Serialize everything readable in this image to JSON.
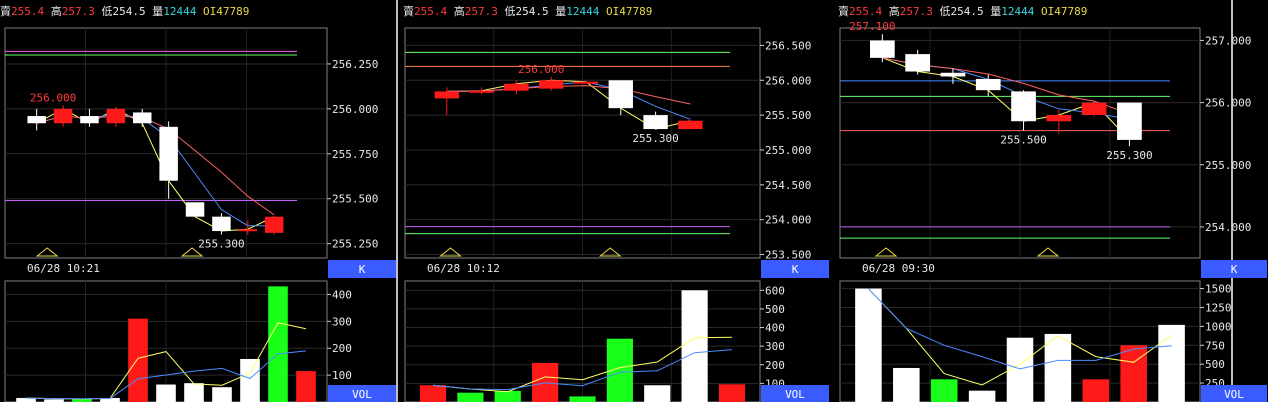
{
  "panels": [
    {
      "stat": {
        "sell_label": "賣",
        "sell": "255.4",
        "high_label": "高",
        "high": "257.3",
        "low_label": "低",
        "low": "254.5",
        "vol_label": "量",
        "vol": "12444",
        "oi_label": "OI",
        "oi": "47789"
      },
      "time_label": "06/28 10:21",
      "k_button": "K",
      "vol_button": "VOL",
      "price_ticks": [
        "256.250",
        "256.000",
        "255.750",
        "255.500",
        "255.250"
      ],
      "vol_ticks": [
        "400",
        "300",
        "200",
        "100"
      ]
    },
    {
      "stat": {
        "sell_label": "賣",
        "sell": "255.4",
        "high_label": "高",
        "high": "257.3",
        "low_label": "低",
        "low": "254.5",
        "vol_label": "量",
        "vol": "12444",
        "oi_label": "OI",
        "oi": "47789"
      },
      "time_label": "06/28 10:12",
      "k_button": "K",
      "vol_button": "VOL",
      "price_ticks": [
        "256.500",
        "256.000",
        "255.500",
        "255.000",
        "254.500",
        "254.000",
        "253.500"
      ],
      "vol_ticks": [
        "600",
        "500",
        "400",
        "300",
        "200",
        "100"
      ]
    },
    {
      "stat": {
        "sell_label": "賣",
        "sell": "255.4",
        "high_label": "高",
        "high": "257.3",
        "low_label": "低",
        "low": "254.5",
        "vol_label": "量",
        "vol": "12444",
        "oi_label": "OI",
        "oi": "47789"
      },
      "time_label": "06/28 09:30",
      "k_button": "K",
      "vol_button": "VOL",
      "price_ticks": [
        "257.000",
        "256.000",
        "255.000",
        "254.000"
      ],
      "vol_ticks": [
        "1500",
        "1250",
        "1000",
        "750",
        "500",
        "250"
      ]
    }
  ],
  "colors": {
    "up": "#ff1a1a",
    "down": "#ffffff",
    "up_vol": "#ff1a1a",
    "down_vol": "#ffffff",
    "green_vol": "#1aff1a",
    "axis_bg": "#3a5bff",
    "label_red": "#ff3b3b"
  },
  "chart_data": [
    {
      "type": "candlestick",
      "price_range": [
        255.17,
        256.45
      ],
      "vol_range": [
        0,
        450
      ],
      "candles": [
        {
          "o": 255.96,
          "c": 255.92,
          "h": 256.0,
          "l": 255.88
        },
        {
          "o": 255.92,
          "c": 256.0,
          "h": 256.02,
          "l": 255.9
        },
        {
          "o": 255.96,
          "c": 255.92,
          "h": 256.0,
          "l": 255.9
        },
        {
          "o": 255.92,
          "c": 256.0,
          "h": 256.01,
          "l": 255.9
        },
        {
          "o": 255.98,
          "c": 255.92,
          "h": 256.0,
          "l": 255.9
        },
        {
          "o": 255.9,
          "c": 255.6,
          "h": 255.93,
          "l": 255.5
        },
        {
          "o": 255.48,
          "c": 255.4,
          "h": 255.48,
          "l": 255.4
        },
        {
          "o": 255.4,
          "c": 255.32,
          "h": 255.42,
          "l": 255.3
        },
        {
          "o": 255.32,
          "c": 255.33,
          "h": 255.38,
          "l": 255.3
        },
        {
          "o": 255.31,
          "c": 255.4,
          "h": 255.4,
          "l": 255.3
        }
      ],
      "hi_label": "256.000",
      "lo_label": "255.300",
      "volumes": [
        15,
        10,
        12,
        15,
        310,
        65,
        70,
        55,
        160,
        430,
        115
      ],
      "vol_colors": [
        "w",
        "w",
        "g",
        "w",
        "r",
        "w",
        "w",
        "w",
        "w",
        "g",
        "r"
      ]
    },
    {
      "type": "candlestick",
      "price_range": [
        253.45,
        256.75
      ],
      "vol_range": [
        0,
        650
      ],
      "candles": [
        {
          "o": 255.74,
          "c": 255.84,
          "h": 255.9,
          "l": 255.5
        },
        {
          "o": 255.85,
          "c": 255.85,
          "h": 255.9,
          "l": 255.8
        },
        {
          "o": 255.85,
          "c": 255.95,
          "h": 256.0,
          "l": 255.8
        },
        {
          "o": 255.88,
          "c": 256.0,
          "h": 256.05,
          "l": 255.85
        },
        {
          "o": 255.98,
          "c": 255.98,
          "h": 256.0,
          "l": 255.95
        },
        {
          "o": 256.0,
          "c": 255.6,
          "h": 256.0,
          "l": 255.5
        },
        {
          "o": 255.5,
          "c": 255.3,
          "h": 255.55,
          "l": 255.3
        },
        {
          "o": 255.3,
          "c": 255.42,
          "h": 255.42,
          "l": 255.3
        }
      ],
      "hi_label": "256.000",
      "lo_label": "255.300",
      "volumes": [
        90,
        50,
        60,
        210,
        30,
        340,
        90,
        600,
        95
      ],
      "vol_colors": [
        "r",
        "g",
        "g",
        "r",
        "g",
        "g",
        "w",
        "w",
        "r"
      ]
    },
    {
      "type": "candlestick",
      "price_range": [
        253.5,
        257.2
      ],
      "vol_range": [
        0,
        1600
      ],
      "candles": [
        {
          "o": 257.0,
          "c": 256.72,
          "h": 257.1,
          "l": 256.65
        },
        {
          "o": 256.78,
          "c": 256.5,
          "h": 256.85,
          "l": 256.45
        },
        {
          "o": 256.48,
          "c": 256.42,
          "h": 256.55,
          "l": 256.3
        },
        {
          "o": 256.38,
          "c": 256.2,
          "h": 256.45,
          "l": 256.1
        },
        {
          "o": 256.18,
          "c": 255.7,
          "h": 256.2,
          "l": 255.55
        },
        {
          "o": 255.7,
          "c": 255.8,
          "h": 255.9,
          "l": 255.5
        },
        {
          "o": 255.8,
          "c": 256.0,
          "h": 256.0,
          "l": 255.78
        },
        {
          "o": 256.0,
          "c": 255.4,
          "h": 256.0,
          "l": 255.3
        }
      ],
      "hi_label": "257.100",
      "lo_labels": [
        "255.500",
        "255.300"
      ],
      "volumes": [
        1500,
        450,
        300,
        150,
        850,
        900,
        300,
        750,
        1020
      ],
      "vol_colors": [
        "w",
        "w",
        "g",
        "w",
        "w",
        "w",
        "r",
        "r",
        "w"
      ]
    }
  ]
}
